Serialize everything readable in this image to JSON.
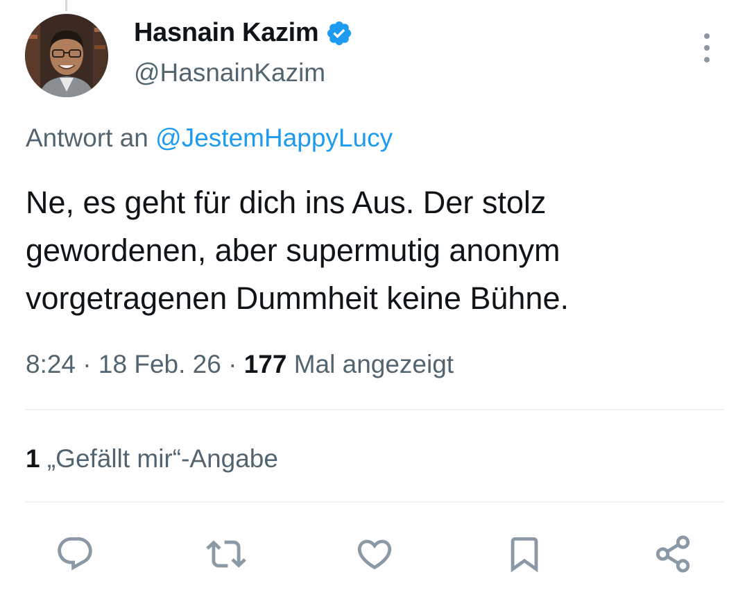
{
  "author": {
    "display_name": "Hasnain Kazim",
    "handle": "@HasnainKazim",
    "verified_icon": "verified-badge-icon"
  },
  "reply_to": {
    "prefix": "Antwort an",
    "mention": "@JestemHappyLucy"
  },
  "tweet": {
    "lines": [
      "Ne, es geht für dich ins Aus. Der stolz",
      "gewordenen, aber supermutig anonym",
      "vorgetragenen Dummheit keine Bühne."
    ]
  },
  "meta": {
    "time": "8:24",
    "sep1": " · ",
    "date": "18 Feb. 26",
    "sep2": " · ",
    "views_count": "177",
    "views_label": " Mal angezeigt"
  },
  "likes": {
    "count": "1",
    "label": " „Gefällt mir“-Angabe"
  },
  "actions": [
    {
      "name": "reply",
      "icon": "reply-icon"
    },
    {
      "name": "retweet",
      "icon": "retweet-icon"
    },
    {
      "name": "like",
      "icon": "heart-icon"
    },
    {
      "name": "bookmark",
      "icon": "bookmark-icon"
    },
    {
      "name": "share",
      "icon": "share-icon"
    }
  ],
  "colors": {
    "text": "#0f1419",
    "secondary": "#536471",
    "accent": "#1d9bf0",
    "divider": "#eff3f4"
  }
}
